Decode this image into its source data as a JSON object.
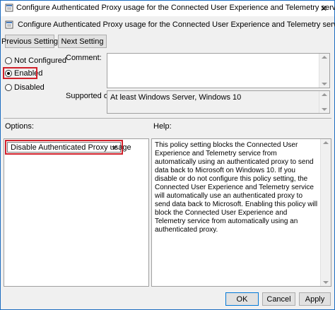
{
  "window": {
    "title": "Configure Authenticated Proxy usage for the Connected User Experience and Telemetry service",
    "close_glyph": "✕"
  },
  "header": {
    "policy_name": "Configure Authenticated Proxy usage for the Connected User Experience and Telemetry service"
  },
  "nav": {
    "previous_label": "Previous Setting",
    "next_label": "Next Setting"
  },
  "state": {
    "options": [
      {
        "label": "Not Configured",
        "selected": false
      },
      {
        "label": "Enabled",
        "selected": true
      },
      {
        "label": "Disabled",
        "selected": false
      }
    ]
  },
  "comment": {
    "label": "Comment:",
    "value": ""
  },
  "supported": {
    "label": "Supported on:",
    "value": "At least Windows Server, Windows 10"
  },
  "options_panel": {
    "label": "Options:",
    "dropdown_value": "Disable Authenticated Proxy usage"
  },
  "help_panel": {
    "label": "Help:",
    "text": "This policy setting blocks the Connected User Experience and Telemetry service from automatically using an authenticated proxy to send data back to Microsoft on Windows 10. If you disable or do not configure this policy setting, the Connected User Experience and Telemetry service will automatically use an authenticated proxy to send data back to Microsoft. Enabling this policy will block the Connected User Experience and Telemetry service from automatically using an authenticated proxy."
  },
  "footer": {
    "ok_label": "OK",
    "cancel_label": "Cancel",
    "apply_label": "Apply"
  },
  "colors": {
    "highlight": "#d0202a",
    "window_border": "#1e6ec1",
    "dialog_bg": "#f0f0f0"
  },
  "icons": {
    "title": "policy-icon",
    "header": "policy-icon",
    "close": "close-icon",
    "dropdown": "chevron-down-icon"
  }
}
